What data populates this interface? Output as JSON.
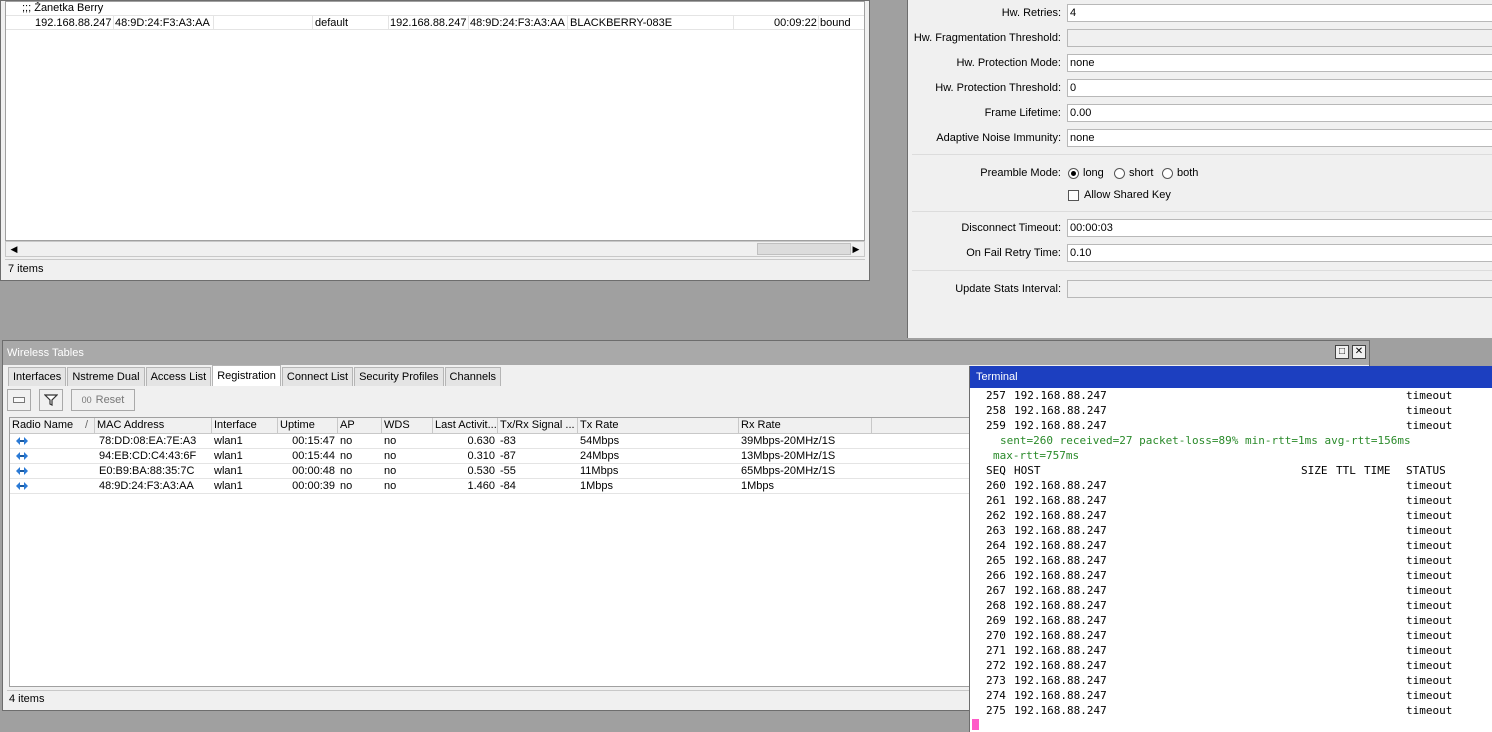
{
  "leases": {
    "comment": ";;; Žanetka Berry",
    "row": {
      "address": "192.168.88.247",
      "mac": "48:9D:24:F3:A3:AA",
      "client_id": "",
      "server": "default",
      "active_address": "192.168.88.247",
      "active_mac": "48:9D:24:F3:A3:AA",
      "hostname": "BLACKBERRY-083E",
      "expires": "00:09:22",
      "status": "bound"
    },
    "status": "7 items"
  },
  "settings": {
    "hw_retries": {
      "label": "Hw. Retries:",
      "value": "4"
    },
    "hw_frag": {
      "label": "Hw. Fragmentation Threshold:",
      "value": ""
    },
    "hw_prot_mode": {
      "label": "Hw. Protection Mode:",
      "value": "none"
    },
    "hw_prot_thresh": {
      "label": "Hw. Protection Threshold:",
      "value": "0"
    },
    "frame_lifetime": {
      "label": "Frame Lifetime:",
      "value": "0.00"
    },
    "adaptive_noise": {
      "label": "Adaptive Noise Immunity:",
      "value": "none"
    },
    "preamble": {
      "label": "Preamble Mode:",
      "options": [
        "long",
        "short",
        "both"
      ],
      "selected": "long"
    },
    "allow_shared_key": {
      "label": "Allow Shared Key",
      "checked": false
    },
    "disconnect_timeout": {
      "label": "Disconnect Timeout:",
      "value": "00:00:03"
    },
    "on_fail_retry": {
      "label": "On Fail Retry Time:",
      "value": "0.10"
    },
    "update_stats": {
      "label": "Update Stats Interval:",
      "value": ""
    }
  },
  "wireless": {
    "title": "Wireless Tables",
    "tabs": [
      "Interfaces",
      "Nstreme Dual",
      "Access List",
      "Registration",
      "Connect List",
      "Security Profiles",
      "Channels"
    ],
    "active_tab": "Registration",
    "reset_label": "Reset",
    "columns": [
      "Radio Name",
      "MAC Address",
      "Interface",
      "Uptime",
      "AP",
      "WDS",
      "Last Activit...",
      "Tx/Rx Signal ...",
      "Tx Rate",
      "Rx Rate"
    ],
    "sort_marker": "/",
    "rows": [
      {
        "mac": "78:DD:08:EA:7E:A3",
        "iface": "wlan1",
        "uptime": "00:15:47",
        "ap": "no",
        "wds": "no",
        "last": "0.630",
        "signal": "-83",
        "tx": "54Mbps",
        "rx": "39Mbps-20MHz/1S"
      },
      {
        "mac": "94:EB:CD:C4:43:6F",
        "iface": "wlan1",
        "uptime": "00:15:44",
        "ap": "no",
        "wds": "no",
        "last": "0.310",
        "signal": "-87",
        "tx": "24Mbps",
        "rx": "13Mbps-20MHz/1S"
      },
      {
        "mac": "E0:B9:BA:88:35:7C",
        "iface": "wlan1",
        "uptime": "00:00:48",
        "ap": "no",
        "wds": "no",
        "last": "0.530",
        "signal": "-55",
        "tx": "11Mbps",
        "rx": "65Mbps-20MHz/1S"
      },
      {
        "mac": "48:9D:24:F3:A3:AA",
        "iface": "wlan1",
        "uptime": "00:00:39",
        "ap": "no",
        "wds": "no",
        "last": "1.460",
        "signal": "-84",
        "tx": "1Mbps",
        "rx": "1Mbps"
      }
    ],
    "status": "4 items"
  },
  "terminal": {
    "title": "Terminal",
    "pre_rows": [
      {
        "seq": "257",
        "host": "192.168.88.247",
        "status": "timeout"
      },
      {
        "seq": "258",
        "host": "192.168.88.247",
        "status": "timeout"
      },
      {
        "seq": "259",
        "host": "192.168.88.247",
        "status": "timeout"
      }
    ],
    "summary1": "sent=260 received=27 packet-loss=89% min-rtt=1ms avg-rtt=156ms",
    "summary2": "max-rtt=757ms",
    "header": {
      "seq": "SEQ",
      "host": "HOST",
      "size": "SIZE",
      "ttl": "TTL",
      "time": "TIME",
      "status": "STATUS"
    },
    "rows": [
      {
        "seq": "260",
        "host": "192.168.88.247",
        "status": "timeout"
      },
      {
        "seq": "261",
        "host": "192.168.88.247",
        "status": "timeout"
      },
      {
        "seq": "262",
        "host": "192.168.88.247",
        "status": "timeout"
      },
      {
        "seq": "263",
        "host": "192.168.88.247",
        "status": "timeout"
      },
      {
        "seq": "264",
        "host": "192.168.88.247",
        "status": "timeout"
      },
      {
        "seq": "265",
        "host": "192.168.88.247",
        "status": "timeout"
      },
      {
        "seq": "266",
        "host": "192.168.88.247",
        "status": "timeout"
      },
      {
        "seq": "267",
        "host": "192.168.88.247",
        "status": "timeout"
      },
      {
        "seq": "268",
        "host": "192.168.88.247",
        "status": "timeout"
      },
      {
        "seq": "269",
        "host": "192.168.88.247",
        "status": "timeout"
      },
      {
        "seq": "270",
        "host": "192.168.88.247",
        "status": "timeout"
      },
      {
        "seq": "271",
        "host": "192.168.88.247",
        "status": "timeout"
      },
      {
        "seq": "272",
        "host": "192.168.88.247",
        "status": "timeout"
      },
      {
        "seq": "273",
        "host": "192.168.88.247",
        "status": "timeout"
      },
      {
        "seq": "274",
        "host": "192.168.88.247",
        "status": "timeout"
      },
      {
        "seq": "275",
        "host": "192.168.88.247",
        "status": "timeout"
      }
    ]
  },
  "colors": {
    "terminal_title": "#1c3fc0",
    "summary_text": "#2a8a2a",
    "cursor": "#ff5ac8",
    "window_title": "#a9a9a9"
  },
  "icons": {
    "radio": "wireless-client-icon",
    "filter": "filter-icon",
    "remove": "remove-icon"
  }
}
